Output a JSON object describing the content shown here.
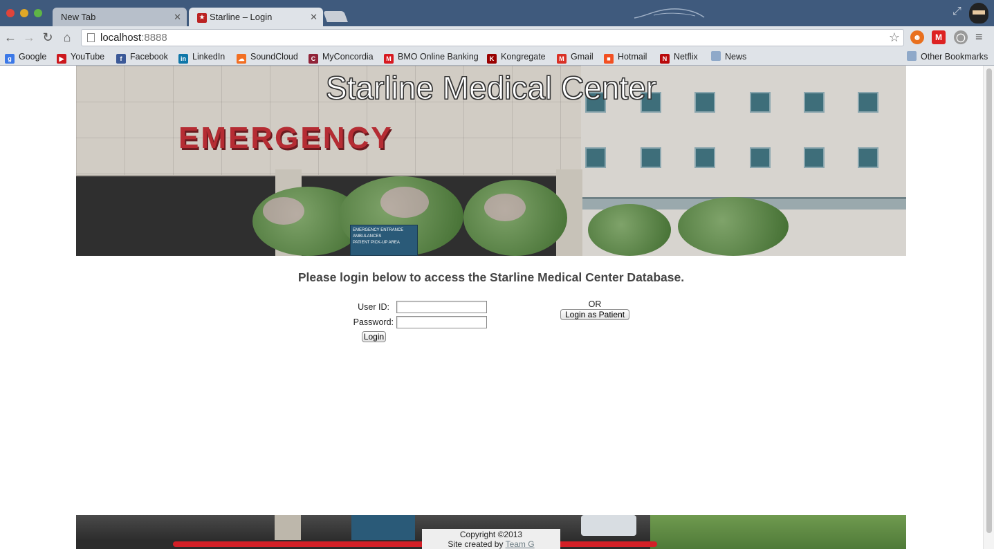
{
  "browser": {
    "tabs": [
      {
        "label": "New Tab",
        "active": false
      },
      {
        "label": "Starline – Login",
        "active": true
      }
    ],
    "url": {
      "host": "localhost",
      "port": ":8888"
    },
    "bookmarks": [
      {
        "label": "Google",
        "icon": "google-icon",
        "color": "#3b78e7"
      },
      {
        "label": "YouTube",
        "icon": "youtube-icon",
        "color": "#cc181e"
      },
      {
        "label": "Facebook",
        "icon": "facebook-icon",
        "color": "#3b5998"
      },
      {
        "label": "LinkedIn",
        "icon": "linkedin-icon",
        "color": "#0e76a8"
      },
      {
        "label": "SoundCloud",
        "icon": "soundcloud-icon",
        "color": "#f26f23"
      },
      {
        "label": "MyConcordia",
        "icon": "myconcordia-icon",
        "color": "#912338"
      },
      {
        "label": "BMO Online Banking",
        "icon": "bmo-icon",
        "color": "#d71920"
      },
      {
        "label": "Kongregate",
        "icon": "kongregate-icon",
        "color": "#990000"
      },
      {
        "label": "Gmail",
        "icon": "gmail-icon",
        "color": "#d93025"
      },
      {
        "label": "Hotmail",
        "icon": "hotmail-icon",
        "color": "#f25022"
      },
      {
        "label": "Netflix",
        "icon": "netflix-icon",
        "color": "#b9090b"
      },
      {
        "label": "News",
        "icon": "folder-icon",
        "color": "#8fa9c9"
      }
    ],
    "other_bookmarks": "Other Bookmarks"
  },
  "page": {
    "site_title": "Starline Medical Center",
    "banner_sign_text": "EMERGENCY",
    "banner_small_sign": [
      "EMERGENCY ENTRANCE",
      "AMBULANCES",
      "PATIENT PICK-UP AREA"
    ],
    "prompt": "Please login below to access the Starline Medical Center Database.",
    "login": {
      "user_label": "User ID:",
      "password_label": "Password:",
      "user_value": "",
      "password_value": "",
      "login_button": "Login"
    },
    "or_text": "OR",
    "patient_button": "Login as Patient",
    "footer": {
      "copyright": "Copyright ©2013",
      "credit_prefix": "Site created by ",
      "credit_link": "Team G"
    }
  }
}
